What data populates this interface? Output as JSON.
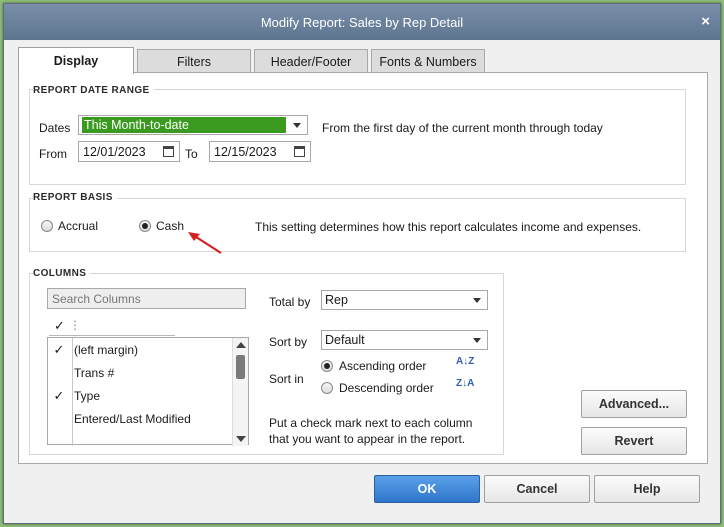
{
  "window": {
    "title": "Modify Report: Sales by Rep Detail",
    "close_glyph": "×"
  },
  "tabs": [
    {
      "label": "Display",
      "active": true
    },
    {
      "label": "Filters",
      "active": false
    },
    {
      "label": "Header/Footer",
      "active": false
    },
    {
      "label": "Fonts & Numbers",
      "active": false
    }
  ],
  "date_range": {
    "section_label": "REPORT DATE RANGE",
    "dates_label": "Dates",
    "dates_value": "This Month-to-date",
    "dates_description": "From the first day of the current month through today",
    "from_label": "From",
    "from_value": "12/01/2023",
    "to_label": "To",
    "to_value": "12/15/2023"
  },
  "report_basis": {
    "section_label": "REPORT BASIS",
    "accrual_label": "Accrual",
    "cash_label": "Cash",
    "selected": "Cash",
    "description": "This setting determines how this report calculates income and expenses."
  },
  "columns": {
    "section_label": "COLUMNS",
    "search_placeholder": "Search Columns",
    "header_check": "✓",
    "header_sep": "⋮",
    "items": [
      {
        "label": "(left margin)",
        "checked": true,
        "check": "✓"
      },
      {
        "label": "Trans #",
        "checked": false,
        "check": ""
      },
      {
        "label": "Type",
        "checked": true,
        "check": "✓"
      },
      {
        "label": "Entered/Last Modified",
        "checked": false,
        "check": ""
      }
    ],
    "total_by_label": "Total by",
    "total_by_value": "Rep",
    "sort_by_label": "Sort by",
    "sort_by_value": "Default",
    "sort_in_label": "Sort in",
    "ascending_label": "Ascending order",
    "descending_label": "Descending order",
    "sort_selected": "Ascending order",
    "ascending_icon_text": "A↓Z",
    "descending_icon_text": "Z↓A",
    "help_text_line1": "Put a check mark next to each column",
    "help_text_line2": "that you want to appear in the report."
  },
  "side_buttons": {
    "advanced": "Advanced...",
    "revert": "Revert"
  },
  "footer_buttons": {
    "ok": "OK",
    "cancel": "Cancel",
    "help": "Help"
  },
  "colors": {
    "title_bar": "#6a819c",
    "selected_date_range": "#3a9a1f",
    "ok_button": "#2f76cc",
    "annotation_arrow": "#d42020"
  }
}
